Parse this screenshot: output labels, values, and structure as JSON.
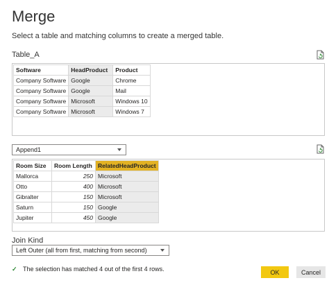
{
  "dialog": {
    "title": "Merge",
    "subtitle": "Select a table and matching columns to create a merged table."
  },
  "table_a": {
    "label": "Table_A",
    "columns": [
      "Software",
      "HeadProduct",
      "Product"
    ],
    "rows": [
      [
        "Company Software",
        "Google",
        "Chrome"
      ],
      [
        "Company Software",
        "Google",
        "Mail"
      ],
      [
        "Company Software",
        "Microsoft",
        "Windows 10"
      ],
      [
        "Company Software",
        "Microsoft",
        "Windows 7"
      ]
    ]
  },
  "second_table": {
    "selected": "Append1",
    "columns": [
      "Room Size",
      "Room Length",
      "RelatedHeadProduct"
    ],
    "rows": [
      [
        "Mallorca",
        "250",
        "Microsoft"
      ],
      [
        "Otto",
        "400",
        "Microsoft"
      ],
      [
        "Gibralter",
        "150",
        "Microsoft"
      ],
      [
        "Saturn",
        "150",
        "Google"
      ],
      [
        "Jupiter",
        "450",
        "Google"
      ]
    ]
  },
  "join": {
    "label": "Join Kind",
    "selected": "Left Outer (all from first, matching from second)"
  },
  "status_text": "The selection has matched 4 out of the first 4 rows.",
  "buttons": {
    "ok": "OK",
    "cancel": "Cancel"
  },
  "icons": {
    "refresh": "refresh-icon",
    "check": "checkmark-icon",
    "caret": "chevron-down-icon"
  },
  "colors": {
    "accent": "#F2C811",
    "selected_column_header": "#E3B224",
    "selected_column_cell": "#EBEBEB",
    "check": "#2F8A35"
  }
}
